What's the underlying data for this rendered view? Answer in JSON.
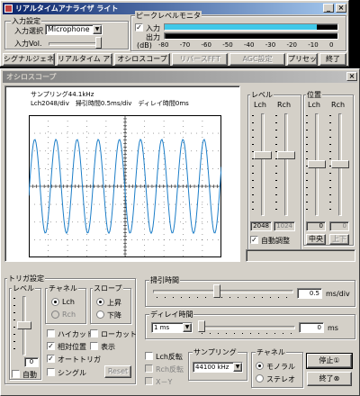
{
  "app": {
    "title": "リアルタイムアナライザ ライト"
  },
  "input_settings": {
    "group_label": "入力設定",
    "input_select_label": "入力選択",
    "input_select_value": "Microphone",
    "input_vol_label": "入力Vol."
  },
  "peak_monitor": {
    "group_label": "ピークレベルモニタ",
    "input_label": "入力",
    "output_label": "出力",
    "scale_unit": "(dB)",
    "scale": [
      "-80",
      "-70",
      "-60",
      "-50",
      "-40",
      "-30",
      "-20",
      "-10",
      "0"
    ],
    "input_level_fraction": 0.88,
    "output_level_fraction": 0.0
  },
  "toolbar": {
    "signal_gen": "シグナルジェネレータ",
    "realtime_analyzer": "リアルタイム アナライザ",
    "oscilloscope": "オシロスコープ",
    "fft": "リバースFFT",
    "agc": "AGC設定",
    "preset": "プリセット",
    "exit": "終了"
  },
  "scope": {
    "window_title": "オシロスコープ",
    "sampling_label": "サンプリング44.1kHz",
    "scale_info": "Lch2048/div　掃引時間0.5ms/div　ディレイ時間0ms",
    "level": {
      "group_label": "レベル",
      "lch": "Lch",
      "rch": "Rch",
      "lch_value": "2048",
      "rch_value": "1024",
      "auto_adjust": "自動調整",
      "lch_fraction": 0.4,
      "rch_fraction": 0.4
    },
    "position": {
      "group_label": "位置",
      "lch": "Lch",
      "rch": "Rch",
      "lch_value": "0",
      "rch_value": "0",
      "center_btn": "中央",
      "up_btn": "上下",
      "lch_fraction": 0.5,
      "rch_fraction": 0.5
    }
  },
  "trigger": {
    "group_label": "トリガ設定",
    "level_label": "レベル",
    "level_value": "0",
    "auto_label": "自動",
    "channel_label": "チャネル",
    "lch": "Lch",
    "rch": "Rch",
    "slope_label": "スロープ",
    "slope_up": "上昇",
    "slope_down": "下降",
    "high_cut": "ハイカット",
    "low_cut": "ローカット",
    "relative_pos": "相対位置",
    "display": "表示",
    "auto_trig": "オートトリガ",
    "single": "シングル",
    "reset": "Reset",
    "level_fraction": 0.5
  },
  "sweep": {
    "group_label": "掃引時間",
    "value": "0.5",
    "unit": "ms/div",
    "fraction": 0.45
  },
  "delay": {
    "group_label": "ディレイ時間",
    "select_value": "1 ms",
    "value": "0",
    "unit": "ms",
    "fraction": 0.0
  },
  "options": {
    "lch_invert": "Lch反転",
    "r_invert": "Rch反転",
    "xy": "X－Y"
  },
  "sampling": {
    "group_label": "サンプリング",
    "value": "44100 kHz"
  },
  "channel": {
    "group_label": "チャネル",
    "mono": "モノラル",
    "stereo": "ステレオ"
  },
  "actions": {
    "stop": "停止①",
    "close": "終了⊗"
  }
}
